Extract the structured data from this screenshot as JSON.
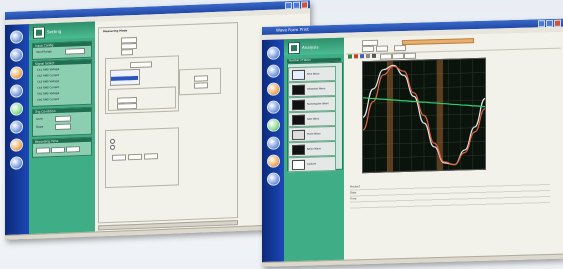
{
  "left_window": {
    "title": "",
    "menu": "",
    "panel_label": "Setting",
    "groups": [
      {
        "label": "Input Config",
        "rows": [
          "Input Range"
        ]
      },
      {
        "label": "Signal Select",
        "rows": [
          "Ch1 RMS Voltage",
          "Ch2 RMS Current",
          "Ch3 RMS Voltage",
          "Ch4 RMS Current",
          "Ch5 RMS Voltage",
          "Ch6 RMS Current"
        ]
      },
      {
        "label": "Trig Condition",
        "rows": [
          "Level",
          "Slope"
        ]
      },
      {
        "label": "Recording Time",
        "rows": []
      }
    ],
    "content_heading": "Measuring Mode"
  },
  "right_window": {
    "title": "Wave Form Print",
    "panel_label": "Analysis",
    "list_header": "Number of Wave",
    "wave_items": [
      "Sine Wave",
      "Distorted Wave",
      "Rectangular Wave",
      "Saw Wave",
      "Pulse Wave",
      "Noise Wave",
      "Custom"
    ],
    "chart_data": {
      "type": "line",
      "series": [
        {
          "color": "#e8e8e8",
          "values": [
            0,
            0.55,
            0.92,
            1.0,
            0.8,
            0.38,
            -0.15,
            -0.62,
            -0.94,
            -0.98,
            -0.7,
            -0.25,
            0.3
          ]
        },
        {
          "color": "#e06040",
          "values": [
            -0.25,
            0.3,
            0.82,
            0.98,
            0.88,
            0.45,
            0.0,
            -0.55,
            -0.92,
            -0.98,
            -0.75,
            -0.35,
            0.1
          ]
        },
        {
          "color": "#30d070",
          "values": [
            0.38,
            0.36,
            0.34,
            0.32,
            0.3,
            0.28,
            0.26,
            0.24,
            0.22,
            0.2,
            0.18,
            0.16,
            0.14
          ]
        }
      ],
      "ylim": [
        -1,
        1
      ],
      "grid": true
    },
    "info": [
      [
        "Product",
        "",
        "",
        ""
      ],
      [
        "Date",
        "",
        "",
        ""
      ],
      [
        "Time",
        "",
        "",
        ""
      ]
    ]
  }
}
